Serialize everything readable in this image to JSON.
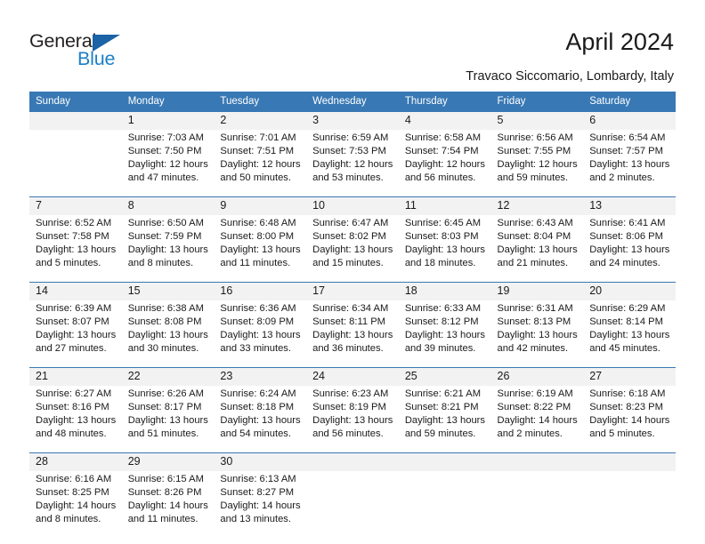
{
  "brand": {
    "name_part1": "General",
    "name_part2": "Blue",
    "accent_color": "#1c7fc4",
    "triangle_color": "#1b62a6",
    "triangle_icon": "brand-triangle-icon"
  },
  "header": {
    "title": "April 2024",
    "subtitle": "Travaco Siccomario, Lombardy, Italy"
  },
  "colors": {
    "header_bg": "#3878b4",
    "daynum_bg": "#f2f2f2",
    "text": "#1a1a1a"
  },
  "weekdays": [
    "Sunday",
    "Monday",
    "Tuesday",
    "Wednesday",
    "Thursday",
    "Friday",
    "Saturday"
  ],
  "weeks": [
    [
      {
        "day": "",
        "sunrise": "",
        "sunset": "",
        "daylight1": "",
        "daylight2": ""
      },
      {
        "day": "1",
        "sunrise": "Sunrise: 7:03 AM",
        "sunset": "Sunset: 7:50 PM",
        "daylight1": "Daylight: 12 hours",
        "daylight2": "and 47 minutes."
      },
      {
        "day": "2",
        "sunrise": "Sunrise: 7:01 AM",
        "sunset": "Sunset: 7:51 PM",
        "daylight1": "Daylight: 12 hours",
        "daylight2": "and 50 minutes."
      },
      {
        "day": "3",
        "sunrise": "Sunrise: 6:59 AM",
        "sunset": "Sunset: 7:53 PM",
        "daylight1": "Daylight: 12 hours",
        "daylight2": "and 53 minutes."
      },
      {
        "day": "4",
        "sunrise": "Sunrise: 6:58 AM",
        "sunset": "Sunset: 7:54 PM",
        "daylight1": "Daylight: 12 hours",
        "daylight2": "and 56 minutes."
      },
      {
        "day": "5",
        "sunrise": "Sunrise: 6:56 AM",
        "sunset": "Sunset: 7:55 PM",
        "daylight1": "Daylight: 12 hours",
        "daylight2": "and 59 minutes."
      },
      {
        "day": "6",
        "sunrise": "Sunrise: 6:54 AM",
        "sunset": "Sunset: 7:57 PM",
        "daylight1": "Daylight: 13 hours",
        "daylight2": "and 2 minutes."
      }
    ],
    [
      {
        "day": "7",
        "sunrise": "Sunrise: 6:52 AM",
        "sunset": "Sunset: 7:58 PM",
        "daylight1": "Daylight: 13 hours",
        "daylight2": "and 5 minutes."
      },
      {
        "day": "8",
        "sunrise": "Sunrise: 6:50 AM",
        "sunset": "Sunset: 7:59 PM",
        "daylight1": "Daylight: 13 hours",
        "daylight2": "and 8 minutes."
      },
      {
        "day": "9",
        "sunrise": "Sunrise: 6:48 AM",
        "sunset": "Sunset: 8:00 PM",
        "daylight1": "Daylight: 13 hours",
        "daylight2": "and 11 minutes."
      },
      {
        "day": "10",
        "sunrise": "Sunrise: 6:47 AM",
        "sunset": "Sunset: 8:02 PM",
        "daylight1": "Daylight: 13 hours",
        "daylight2": "and 15 minutes."
      },
      {
        "day": "11",
        "sunrise": "Sunrise: 6:45 AM",
        "sunset": "Sunset: 8:03 PM",
        "daylight1": "Daylight: 13 hours",
        "daylight2": "and 18 minutes."
      },
      {
        "day": "12",
        "sunrise": "Sunrise: 6:43 AM",
        "sunset": "Sunset: 8:04 PM",
        "daylight1": "Daylight: 13 hours",
        "daylight2": "and 21 minutes."
      },
      {
        "day": "13",
        "sunrise": "Sunrise: 6:41 AM",
        "sunset": "Sunset: 8:06 PM",
        "daylight1": "Daylight: 13 hours",
        "daylight2": "and 24 minutes."
      }
    ],
    [
      {
        "day": "14",
        "sunrise": "Sunrise: 6:39 AM",
        "sunset": "Sunset: 8:07 PM",
        "daylight1": "Daylight: 13 hours",
        "daylight2": "and 27 minutes."
      },
      {
        "day": "15",
        "sunrise": "Sunrise: 6:38 AM",
        "sunset": "Sunset: 8:08 PM",
        "daylight1": "Daylight: 13 hours",
        "daylight2": "and 30 minutes."
      },
      {
        "day": "16",
        "sunrise": "Sunrise: 6:36 AM",
        "sunset": "Sunset: 8:09 PM",
        "daylight1": "Daylight: 13 hours",
        "daylight2": "and 33 minutes."
      },
      {
        "day": "17",
        "sunrise": "Sunrise: 6:34 AM",
        "sunset": "Sunset: 8:11 PM",
        "daylight1": "Daylight: 13 hours",
        "daylight2": "and 36 minutes."
      },
      {
        "day": "18",
        "sunrise": "Sunrise: 6:33 AM",
        "sunset": "Sunset: 8:12 PM",
        "daylight1": "Daylight: 13 hours",
        "daylight2": "and 39 minutes."
      },
      {
        "day": "19",
        "sunrise": "Sunrise: 6:31 AM",
        "sunset": "Sunset: 8:13 PM",
        "daylight1": "Daylight: 13 hours",
        "daylight2": "and 42 minutes."
      },
      {
        "day": "20",
        "sunrise": "Sunrise: 6:29 AM",
        "sunset": "Sunset: 8:14 PM",
        "daylight1": "Daylight: 13 hours",
        "daylight2": "and 45 minutes."
      }
    ],
    [
      {
        "day": "21",
        "sunrise": "Sunrise: 6:27 AM",
        "sunset": "Sunset: 8:16 PM",
        "daylight1": "Daylight: 13 hours",
        "daylight2": "and 48 minutes."
      },
      {
        "day": "22",
        "sunrise": "Sunrise: 6:26 AM",
        "sunset": "Sunset: 8:17 PM",
        "daylight1": "Daylight: 13 hours",
        "daylight2": "and 51 minutes."
      },
      {
        "day": "23",
        "sunrise": "Sunrise: 6:24 AM",
        "sunset": "Sunset: 8:18 PM",
        "daylight1": "Daylight: 13 hours",
        "daylight2": "and 54 minutes."
      },
      {
        "day": "24",
        "sunrise": "Sunrise: 6:23 AM",
        "sunset": "Sunset: 8:19 PM",
        "daylight1": "Daylight: 13 hours",
        "daylight2": "and 56 minutes."
      },
      {
        "day": "25",
        "sunrise": "Sunrise: 6:21 AM",
        "sunset": "Sunset: 8:21 PM",
        "daylight1": "Daylight: 13 hours",
        "daylight2": "and 59 minutes."
      },
      {
        "day": "26",
        "sunrise": "Sunrise: 6:19 AM",
        "sunset": "Sunset: 8:22 PM",
        "daylight1": "Daylight: 14 hours",
        "daylight2": "and 2 minutes."
      },
      {
        "day": "27",
        "sunrise": "Sunrise: 6:18 AM",
        "sunset": "Sunset: 8:23 PM",
        "daylight1": "Daylight: 14 hours",
        "daylight2": "and 5 minutes."
      }
    ],
    [
      {
        "day": "28",
        "sunrise": "Sunrise: 6:16 AM",
        "sunset": "Sunset: 8:25 PM",
        "daylight1": "Daylight: 14 hours",
        "daylight2": "and 8 minutes."
      },
      {
        "day": "29",
        "sunrise": "Sunrise: 6:15 AM",
        "sunset": "Sunset: 8:26 PM",
        "daylight1": "Daylight: 14 hours",
        "daylight2": "and 11 minutes."
      },
      {
        "day": "30",
        "sunrise": "Sunrise: 6:13 AM",
        "sunset": "Sunset: 8:27 PM",
        "daylight1": "Daylight: 14 hours",
        "daylight2": "and 13 minutes."
      },
      {
        "day": "",
        "sunrise": "",
        "sunset": "",
        "daylight1": "",
        "daylight2": ""
      },
      {
        "day": "",
        "sunrise": "",
        "sunset": "",
        "daylight1": "",
        "daylight2": ""
      },
      {
        "day": "",
        "sunrise": "",
        "sunset": "",
        "daylight1": "",
        "daylight2": ""
      },
      {
        "day": "",
        "sunrise": "",
        "sunset": "",
        "daylight1": "",
        "daylight2": ""
      }
    ]
  ]
}
